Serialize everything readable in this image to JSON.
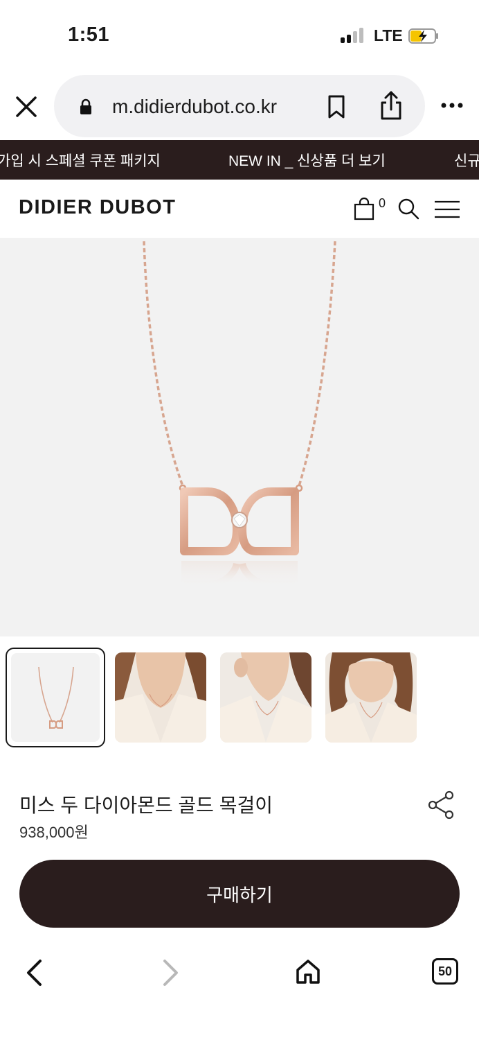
{
  "status": {
    "time": "1:51",
    "network": "LTE"
  },
  "browser": {
    "url": "m.didierdubot.co.kr",
    "tab_count": "50"
  },
  "banner": {
    "items": [
      "가입 시 스페셜 쿠폰 패키지",
      "NEW IN _ 신상품 더 보기",
      "신규"
    ]
  },
  "header": {
    "logo": "DIDIER DUBOT",
    "cart_count": "0"
  },
  "product": {
    "name": "미스 두 다이아몬드 골드 목걸이",
    "price": "938,000원",
    "buy_label": "구매하기",
    "thumbnail_count": 4,
    "selected_thumbnail": 1
  },
  "colors": {
    "brand_dark": "#2a1d1d",
    "rose_gold": "#d9a48b",
    "hero_bg": "#f2f2f2"
  },
  "icons": [
    "close-icon",
    "lock-icon",
    "bookmark-icon",
    "share-icon",
    "more-icon",
    "cart-icon",
    "search-icon",
    "menu-icon",
    "share-node-icon",
    "back-icon",
    "forward-icon",
    "home-icon",
    "tabs-icon"
  ]
}
